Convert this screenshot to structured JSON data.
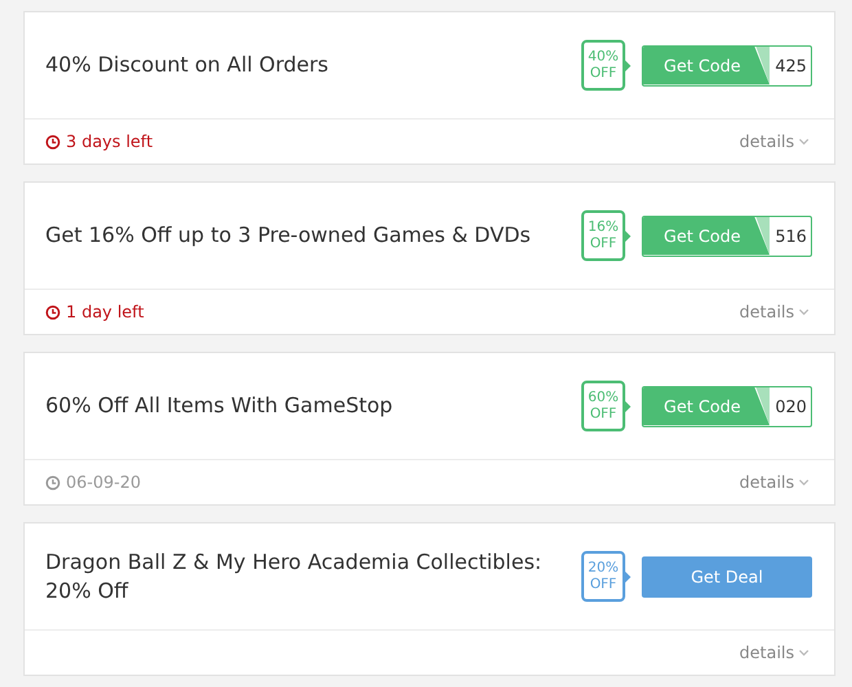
{
  "offers": [
    {
      "title": "40% Discount on All Orders",
      "badge_value": "40%",
      "badge_unit": "OFF",
      "kind": "code",
      "button": "Get Code",
      "code_tail": "425",
      "expiry": {
        "kind": "urgent",
        "text": "3 days left"
      },
      "details": "details"
    },
    {
      "title": "Get 16% Off up to 3 Pre-owned Games & DVDs",
      "badge_value": "16%",
      "badge_unit": "OFF",
      "kind": "code",
      "button": "Get Code",
      "code_tail": "516",
      "expiry": {
        "kind": "urgent",
        "text": "1 day left"
      },
      "details": "details"
    },
    {
      "title": "60% Off All Items With GameStop",
      "badge_value": "60%",
      "badge_unit": "OFF",
      "kind": "code",
      "button": "Get Code",
      "code_tail": "020",
      "expiry": {
        "kind": "date",
        "text": "06-09-20"
      },
      "details": "details"
    },
    {
      "title": "Dragon Ball Z & My Hero Academia Collectibles: 20% Off",
      "badge_value": "20%",
      "badge_unit": "OFF",
      "kind": "deal",
      "button": "Get Deal",
      "details": "details"
    }
  ]
}
